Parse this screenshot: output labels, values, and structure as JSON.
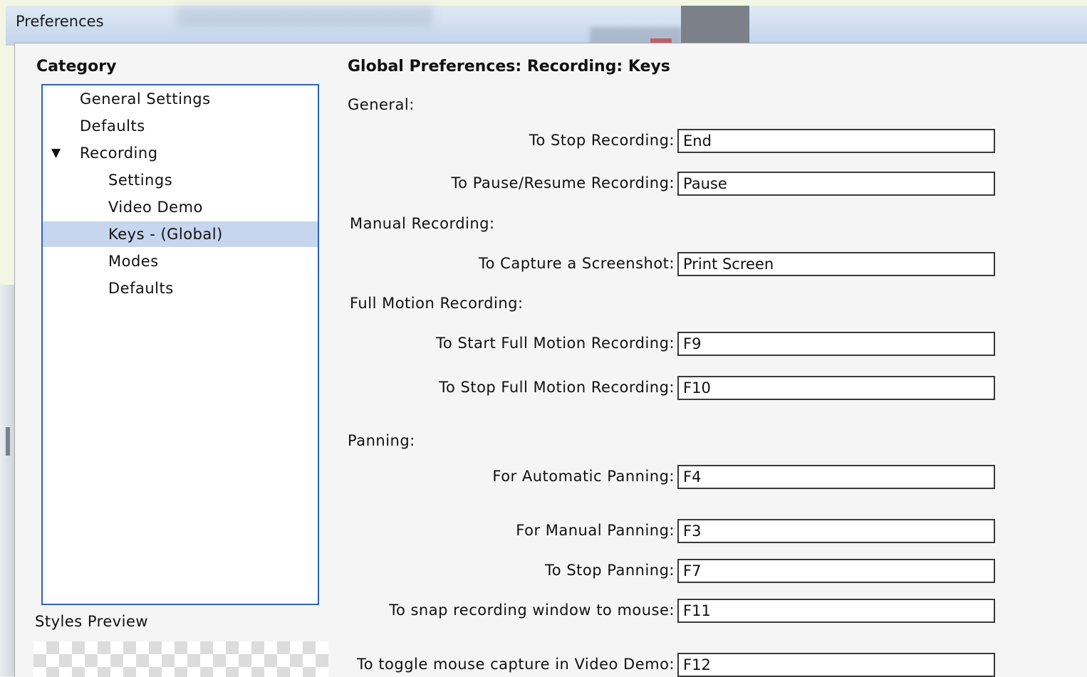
{
  "window": {
    "title": "Preferences"
  },
  "category": {
    "heading": "Category",
    "items": [
      {
        "label": "General Settings"
      },
      {
        "label": "Defaults"
      },
      {
        "label": "Recording"
      },
      {
        "label": "Settings"
      },
      {
        "label": "Video Demo"
      },
      {
        "label": "Keys - (Global)"
      },
      {
        "label": "Modes"
      },
      {
        "label": "Defaults"
      }
    ],
    "selected_item": "Keys - (Global)",
    "expander_glyph": "▼"
  },
  "styles_preview": {
    "heading": "Styles Preview"
  },
  "preferences": {
    "title": "Global Preferences: Recording: Keys",
    "sections": {
      "general": "General:",
      "manual": "Manual Recording:",
      "full_motion": "Full Motion Recording:",
      "panning": "Panning:"
    },
    "keys": [
      {
        "label": "To Stop Recording:",
        "value": "End"
      },
      {
        "label": "To Pause/Resume Recording:",
        "value": "Pause"
      },
      {
        "label": "To Capture a Screenshot:",
        "value": "Print Screen"
      },
      {
        "label": "To Start Full Motion Recording:",
        "value": "F9"
      },
      {
        "label": "To Stop Full Motion Recording:",
        "value": "F10"
      },
      {
        "label": "For Automatic Panning:",
        "value": "F4"
      },
      {
        "label": "For Manual Panning:",
        "value": "F3"
      },
      {
        "label": "To Stop Panning:",
        "value": "F7"
      },
      {
        "label": "To snap recording window to mouse:",
        "value": "F11"
      },
      {
        "label": "To toggle mouse capture in Video Demo:",
        "value": "F12"
      }
    ]
  },
  "colors": {
    "selection": "#c7d6ef",
    "tree_border": "#2f63b9",
    "background": "#f5f5f5"
  }
}
